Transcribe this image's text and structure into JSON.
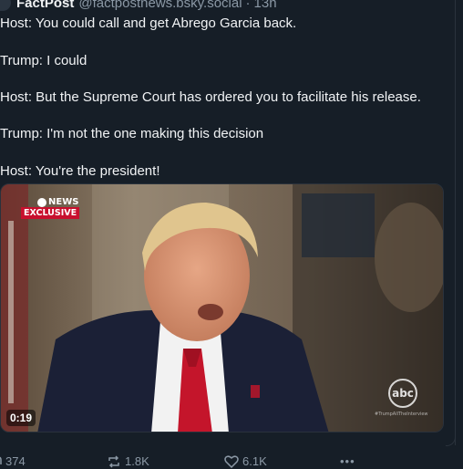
{
  "post": {
    "author_name": "FactPost",
    "author_handle": "@factpostnews.bsky.social",
    "separator": "·",
    "timestamp": "13h",
    "lines": [
      "Host: You could call and get Abrego Garcia back.",
      "Trump: I could",
      "Host: But the Supreme Court has ordered you to facilitate his release.",
      "Trump: I'm not the one making this decision",
      "Host: You're the president!"
    ]
  },
  "video": {
    "network_logo": "NEWS",
    "badge": "EXCLUSIVE",
    "duration": "0:19",
    "watermark": "abc",
    "hashtag": "#TrumpAllTheInterview"
  },
  "actions": {
    "replies": "374",
    "reposts": "1.8K",
    "likes": "6.1K",
    "more": "•••"
  },
  "colors": {
    "background": "#161e27",
    "text": "#f1f3f5",
    "muted": "#8b98a5",
    "badge_red": "#c8102e"
  }
}
